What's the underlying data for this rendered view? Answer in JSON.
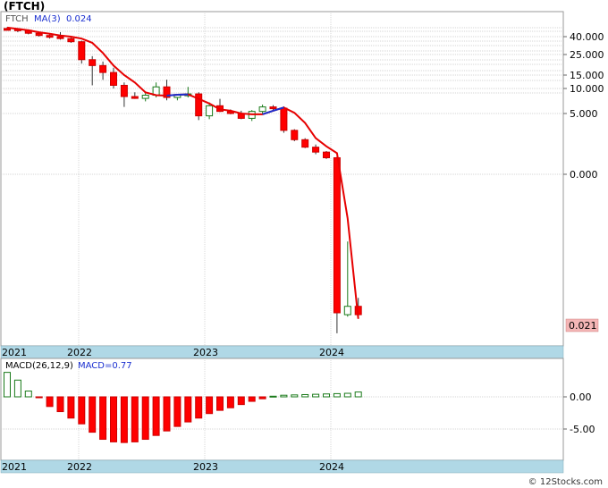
{
  "title": "(FTCH)",
  "watermark": "© 12Stocks.com",
  "price_panel": {
    "legend_symbol": "FTCH",
    "legend_ma": "MA(3)",
    "legend_ma_value": "0.024",
    "last_price_label": "0.021",
    "y_tick_labels": [
      "40.000",
      "25.000",
      "15.000",
      "10.000",
      "5.000",
      "0.000"
    ],
    "colors": {
      "up": "#1a7a1a",
      "down": "#ff0000",
      "ma_down": "#e60000",
      "ma_up": "#1a2fd0",
      "last_badge": "#f4b6b6"
    }
  },
  "macd_panel": {
    "legend_macd": "MACD(26,12,9)",
    "legend_value_label": "MACD=0.77",
    "y_tick_labels": [
      "0.00",
      "-5.00"
    ],
    "colors": {
      "positive": "#1a7a1a",
      "negative": "#ff0000"
    }
  },
  "x_axis": {
    "labels": [
      "2021",
      "2022",
      "2023",
      "2024"
    ],
    "band_color": "#b0d8e6"
  },
  "chart_data": [
    {
      "type": "candlestick",
      "title": "(FTCH)",
      "frequency": "monthly",
      "y_scale": "log",
      "y_tick_values": [
        40,
        25,
        15,
        10,
        5,
        0
      ],
      "x_labels": [
        "2021",
        "2022",
        "2023",
        "2024"
      ],
      "series": [
        {
          "name": "FTCH",
          "candles": [
            {
              "o": 56,
              "h": 59,
              "l": 53,
              "c": 55
            },
            {
              "o": 55,
              "h": 57,
              "l": 48,
              "c": 52
            },
            {
              "o": 52,
              "h": 54,
              "l": 44,
              "c": 46
            },
            {
              "o": 46,
              "h": 48,
              "l": 40,
              "c": 42
            },
            {
              "o": 42,
              "h": 46,
              "l": 38,
              "c": 40
            },
            {
              "o": 40,
              "h": 48,
              "l": 37,
              "c": 38
            },
            {
              "o": 38,
              "h": 40,
              "l": 34,
              "c": 35
            },
            {
              "o": 35,
              "h": 36,
              "l": 20,
              "c": 22
            },
            {
              "o": 22,
              "h": 24,
              "l": 11,
              "c": 19
            },
            {
              "o": 19,
              "h": 21,
              "l": 13,
              "c": 16
            },
            {
              "o": 16,
              "h": 18,
              "l": 10,
              "c": 11
            },
            {
              "o": 11,
              "h": 12,
              "l": 6,
              "c": 8
            },
            {
              "o": 8,
              "h": 9,
              "l": 7.5,
              "c": 7.6
            },
            {
              "o": 7.6,
              "h": 9,
              "l": 7,
              "c": 8.3
            },
            {
              "o": 8.3,
              "h": 12,
              "l": 7.8,
              "c": 10.5
            },
            {
              "o": 10.5,
              "h": 13,
              "l": 7.2,
              "c": 7.8
            },
            {
              "o": 7.8,
              "h": 8.5,
              "l": 7.2,
              "c": 8.4
            },
            {
              "o": 8.4,
              "h": 10.5,
              "l": 7.8,
              "c": 8.6
            },
            {
              "o": 8.6,
              "h": 9,
              "l": 4.2,
              "c": 4.7
            },
            {
              "o": 4.7,
              "h": 6.8,
              "l": 4.3,
              "c": 6.2
            },
            {
              "o": 6.2,
              "h": 7.5,
              "l": 5.2,
              "c": 5.3
            },
            {
              "o": 5.3,
              "h": 5.6,
              "l": 4.9,
              "c": 5.0
            },
            {
              "o": 5.0,
              "h": 5.4,
              "l": 4.3,
              "c": 4.4
            },
            {
              "o": 4.4,
              "h": 5.5,
              "l": 4.1,
              "c": 5.3
            },
            {
              "o": 5.3,
              "h": 6.4,
              "l": 4.9,
              "c": 6.0
            },
            {
              "o": 6.0,
              "h": 6.3,
              "l": 5.5,
              "c": 5.8
            },
            {
              "o": 5.8,
              "h": 6.1,
              "l": 3.0,
              "c": 3.2
            },
            {
              "o": 3.2,
              "h": 3.3,
              "l": 2.4,
              "c": 2.5
            },
            {
              "o": 2.5,
              "h": 2.6,
              "l": 2.0,
              "c": 2.05
            },
            {
              "o": 2.05,
              "h": 2.2,
              "l": 1.7,
              "c": 1.8
            },
            {
              "o": 1.8,
              "h": 1.85,
              "l": 1.5,
              "c": 1.55
            },
            {
              "o": 1.55,
              "h": 1.6,
              "l": 0.014,
              "c": 0.03
            },
            {
              "o": 0.028,
              "h": 0.13,
              "l": 0.026,
              "c": 0.034
            },
            {
              "o": 0.034,
              "h": 0.04,
              "l": 0.024,
              "c": 0.028
            }
          ]
        },
        {
          "name": "MA(3)",
          "values": [
            58,
            55,
            52,
            48,
            45,
            42,
            40,
            38,
            34,
            26,
            19,
            15,
            12,
            9,
            8.3,
            8.2,
            8.4,
            8.5,
            7.5,
            6.6,
            5.6,
            5.4,
            5.0,
            4.9,
            4.9,
            5.4,
            5.9,
            5.1,
            3.9,
            2.6,
            2.1,
            1.75,
            0.26,
            0.024
          ]
        }
      ]
    },
    {
      "type": "bar",
      "title": "MACD(26,12,9)",
      "ylim": [
        -7.1,
        4.2
      ],
      "y_tick_values": [
        0,
        -5
      ],
      "series": [
        {
          "name": "MACD",
          "values": [
            3.8,
            2.6,
            0.9,
            -0.1,
            -1.5,
            -2.3,
            -3.3,
            -4.2,
            -5.5,
            -6.6,
            -7.0,
            -7.1,
            -7.0,
            -6.6,
            -6.0,
            -5.3,
            -4.6,
            -3.9,
            -3.3,
            -2.6,
            -2.1,
            -1.7,
            -1.2,
            -0.7,
            -0.3,
            0.1,
            0.25,
            0.3,
            0.35,
            0.4,
            0.45,
            0.5,
            0.55,
            0.75
          ]
        }
      ]
    }
  ]
}
